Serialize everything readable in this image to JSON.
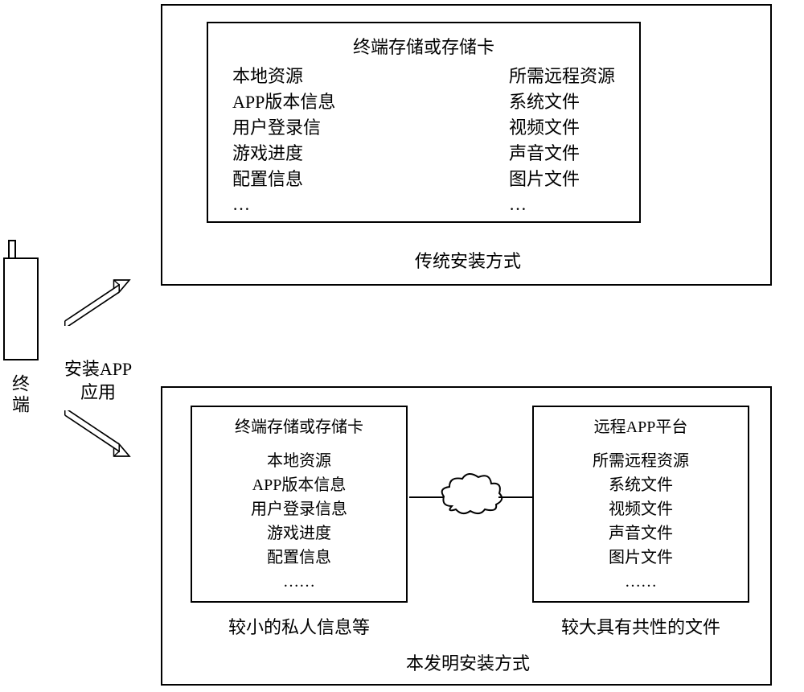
{
  "terminal": {
    "label": "终端"
  },
  "installLabel": "安装APP\n应用",
  "topBox": {
    "innerTitle": "终端存储或存储卡",
    "leftCol": "本地资源\nAPP版本信息\n用户登录信\n游戏进度\n配置信息\n…",
    "rightCol": "所需远程资源\n系统文件\n视频文件\n声音文件\n图片文件\n…",
    "caption": "传统安装方式"
  },
  "bottomBox": {
    "leftInner": {
      "title": "终端存储或存储卡",
      "body": "本地资源\nAPP版本信息\n用户登录信息\n游戏进度\n配置信息\n……",
      "caption": "较小的私人信息等"
    },
    "rightInner": {
      "title": "远程APP平台",
      "body": "所需远程资源\n系统文件\n视频文件\n声音文件\n图片文件\n……",
      "caption": "较大具有共性的文件"
    },
    "caption": "本发明安装方式"
  }
}
